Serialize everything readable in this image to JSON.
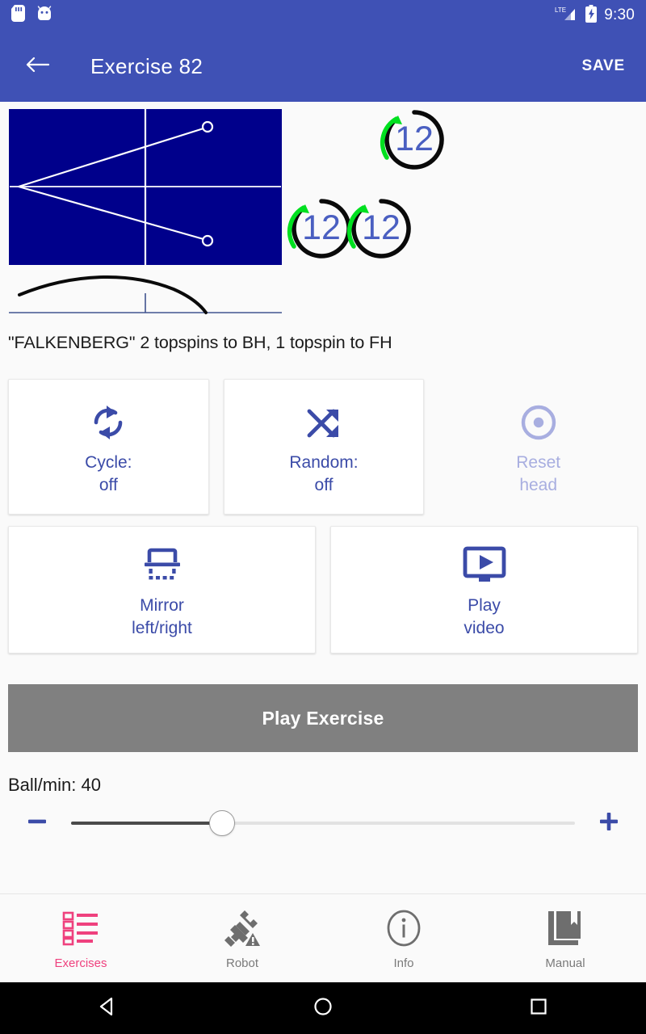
{
  "status_bar": {
    "icons_left": [
      "sd-card-icon",
      "android-robot-icon"
    ],
    "network_label": "LTE",
    "icons_right": [
      "signal-icon",
      "battery-charging-icon"
    ],
    "time": "9:30"
  },
  "app_bar": {
    "back_icon": "back-arrow-icon",
    "title": "Exercise 82",
    "save_label": "SAVE"
  },
  "diagram": {
    "description": "\"FALKENBERG\" 2 topspins to BH, 1 topspin to FH",
    "table_color": "#00008B",
    "line_color": "#ffffff",
    "spin_indicators": [
      {
        "value": "12",
        "arrow_color": "#00e020",
        "ring_color": "#000000",
        "text_color": "#4a5fc1"
      },
      {
        "value": "12",
        "arrow_color": "#00e020",
        "ring_color": "#000000",
        "text_color": "#4a5fc1"
      },
      {
        "value": "12",
        "arrow_color": "#00e020",
        "ring_color": "#000000",
        "text_color": "#4a5fc1"
      }
    ]
  },
  "options": {
    "row1": [
      {
        "icon": "cycle-loop-icon",
        "label": "Cycle:\noff",
        "line1": "Cycle:",
        "line2": "off",
        "disabled": false
      },
      {
        "icon": "shuffle-icon",
        "label": "Random:\noff",
        "line1": "Random:",
        "line2": "off",
        "disabled": false
      },
      {
        "icon": "reset-target-icon",
        "label": "Reset\nhead",
        "line1": "Reset",
        "line2": "head",
        "disabled": true
      }
    ],
    "row2": [
      {
        "icon": "mirror-horizontal-icon",
        "line1": "Mirror",
        "line2": "left/right",
        "disabled": false
      },
      {
        "icon": "play-video-monitor-icon",
        "line1": "Play",
        "line2": "video",
        "disabled": false
      }
    ]
  },
  "play_exercise": {
    "label": "Play Exercise",
    "background": "#808080"
  },
  "ball_rate": {
    "label": "Ball/min: 40",
    "value": 40,
    "minus_icon": "minus-icon",
    "plus_icon": "plus-icon",
    "percent": 30
  },
  "bottom_nav": {
    "items": [
      {
        "icon": "list-checklist-icon",
        "label": "Exercises",
        "active": true
      },
      {
        "icon": "robot-disconnected-warning-icon",
        "label": "Robot",
        "active": false
      },
      {
        "icon": "info-circle-icon",
        "label": "Info",
        "active": false
      },
      {
        "icon": "manual-book-icon",
        "label": "Manual",
        "active": false
      }
    ],
    "active_color": "#ef417e",
    "inactive_color": "#7a7a7a"
  },
  "system_nav": {
    "buttons": [
      "back-triangle-icon",
      "home-circle-icon",
      "recents-square-icon"
    ]
  },
  "theme": {
    "primary": "#3f51b5",
    "accent_text": "#3b4ba8"
  }
}
